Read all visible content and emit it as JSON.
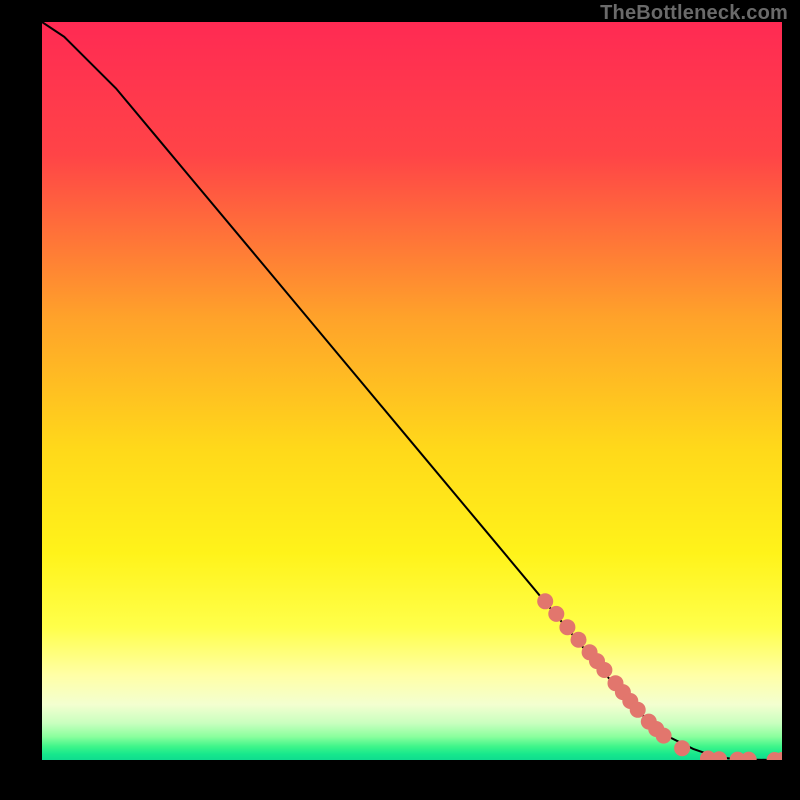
{
  "watermark": "TheBottleneck.com",
  "chart_data": {
    "type": "line",
    "title": "",
    "xlabel": "",
    "ylabel": "",
    "xlim": [
      0,
      100
    ],
    "ylim": [
      0,
      100
    ],
    "grid": false,
    "legend": false,
    "series": [
      {
        "name": "curve",
        "color": "#000000",
        "x": [
          0,
          3,
          6,
          10,
          15,
          20,
          30,
          40,
          50,
          60,
          70,
          80,
          85,
          88,
          90,
          92,
          94,
          96,
          98,
          100
        ],
        "y": [
          100,
          98,
          95,
          91,
          85,
          79,
          67,
          55,
          43,
          31,
          19,
          7,
          3,
          1.5,
          0.8,
          0.3,
          0.1,
          0.05,
          0.02,
          0
        ]
      }
    ],
    "highlight_points": {
      "name": "dots",
      "color": "#e2766d",
      "points": [
        {
          "x": 68,
          "y": 21.5
        },
        {
          "x": 69.5,
          "y": 19.8
        },
        {
          "x": 71,
          "y": 18.0
        },
        {
          "x": 72.5,
          "y": 16.3
        },
        {
          "x": 74,
          "y": 14.6
        },
        {
          "x": 75,
          "y": 13.4
        },
        {
          "x": 76,
          "y": 12.2
        },
        {
          "x": 77.5,
          "y": 10.4
        },
        {
          "x": 78.5,
          "y": 9.2
        },
        {
          "x": 79.5,
          "y": 8.0
        },
        {
          "x": 80.5,
          "y": 6.8
        },
        {
          "x": 82,
          "y": 5.2
        },
        {
          "x": 83,
          "y": 4.2
        },
        {
          "x": 84,
          "y": 3.3
        },
        {
          "x": 86.5,
          "y": 1.6
        },
        {
          "x": 90,
          "y": 0.2
        },
        {
          "x": 91.5,
          "y": 0.1
        },
        {
          "x": 94,
          "y": 0.05
        },
        {
          "x": 95.5,
          "y": 0.05
        },
        {
          "x": 99,
          "y": 0.0
        },
        {
          "x": 100,
          "y": 0.0
        }
      ]
    },
    "gradient_bands": [
      {
        "stop": 0.0,
        "color": "#ff2a53"
      },
      {
        "stop": 0.18,
        "color": "#ff4447"
      },
      {
        "stop": 0.4,
        "color": "#ffa22a"
      },
      {
        "stop": 0.58,
        "color": "#ffd91a"
      },
      {
        "stop": 0.72,
        "color": "#fff31a"
      },
      {
        "stop": 0.82,
        "color": "#ffff4a"
      },
      {
        "stop": 0.885,
        "color": "#ffffa6"
      },
      {
        "stop": 0.925,
        "color": "#f3ffd0"
      },
      {
        "stop": 0.95,
        "color": "#c9ffbf"
      },
      {
        "stop": 0.968,
        "color": "#8cff9e"
      },
      {
        "stop": 0.982,
        "color": "#3df58a"
      },
      {
        "stop": 0.992,
        "color": "#17e88c"
      },
      {
        "stop": 1.0,
        "color": "#0fdc8f"
      }
    ]
  }
}
